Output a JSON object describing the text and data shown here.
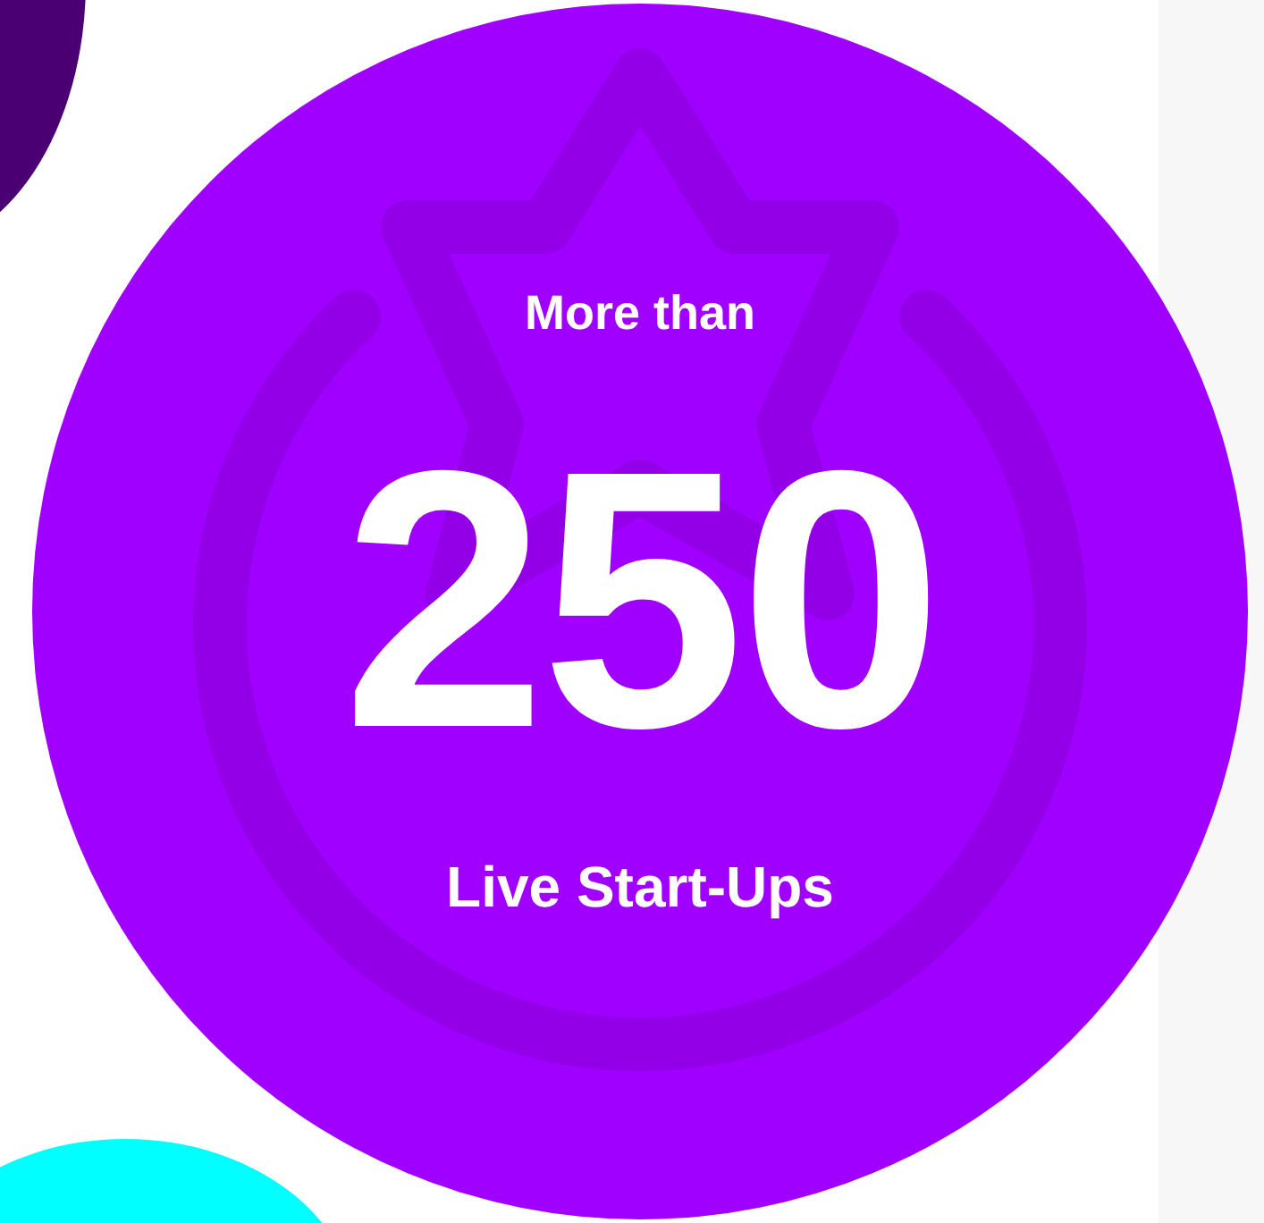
{
  "stat": {
    "prefix": "More than",
    "value": "250",
    "label": "Live Start-Ups"
  }
}
